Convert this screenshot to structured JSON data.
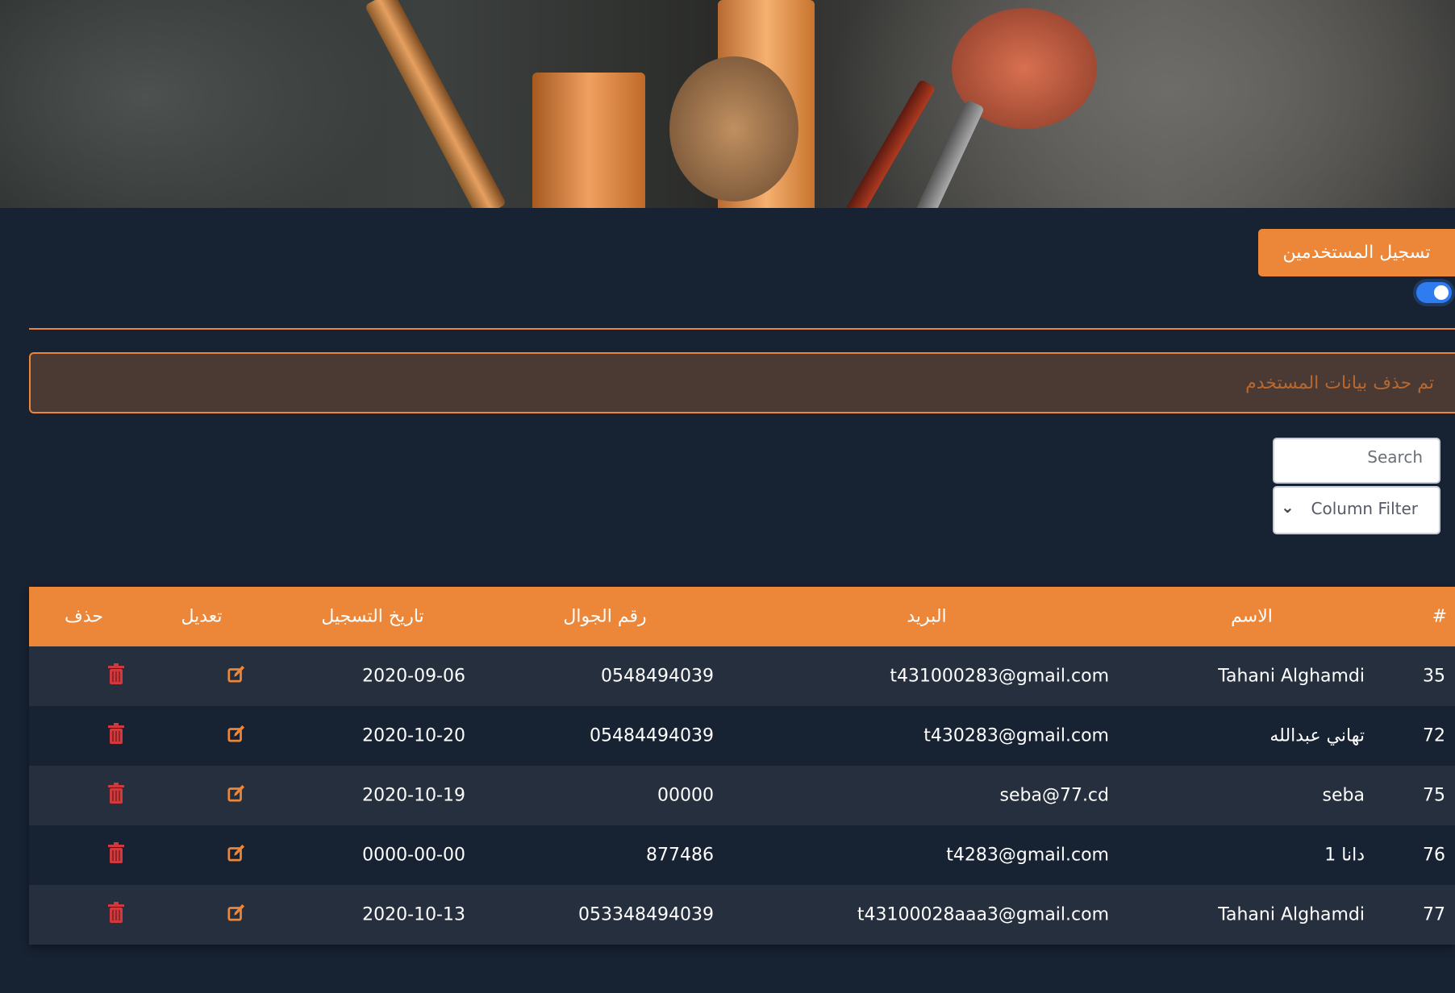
{
  "header": {
    "register_button": "تسجيل المستخدمين",
    "toggle_on": true
  },
  "alert": {
    "message": "تم حذف بيانات المستخدم"
  },
  "search": {
    "placeholder": "Search"
  },
  "column_filter": {
    "label": "Column Filter"
  },
  "colors": {
    "accent": "#ec8638",
    "background": "#172233",
    "row_alt": "#252f3e",
    "delete": "#d0393d",
    "toggle": "#2f7cf0"
  },
  "table": {
    "columns": [
      "#",
      "الاسم",
      "البريد",
      "رقم الجوال",
      "تاريخ التسجيل",
      "تعديل",
      "حذف"
    ],
    "rows": [
      {
        "id": "35",
        "name": "Tahani Alghamdi",
        "email": "t431000283@gmail.com",
        "phone": "0548494039",
        "date": "2020-09-06"
      },
      {
        "id": "72",
        "name": "تهاني عبدالله",
        "email": "t430283@gmail.com",
        "phone": "05484494039",
        "date": "2020-10-20"
      },
      {
        "id": "75",
        "name": "seba",
        "email": "seba@77.cd",
        "phone": "00000",
        "date": "2020-10-19"
      },
      {
        "id": "76",
        "name": "دانا 1",
        "email": "t4283@gmail.com",
        "phone": "877486",
        "date": "0000-00-00"
      },
      {
        "id": "77",
        "name": "Tahani Alghamdi",
        "email": "t43100028aaa3@gmail.com",
        "phone": "053348494039",
        "date": "2020-10-13"
      }
    ]
  }
}
